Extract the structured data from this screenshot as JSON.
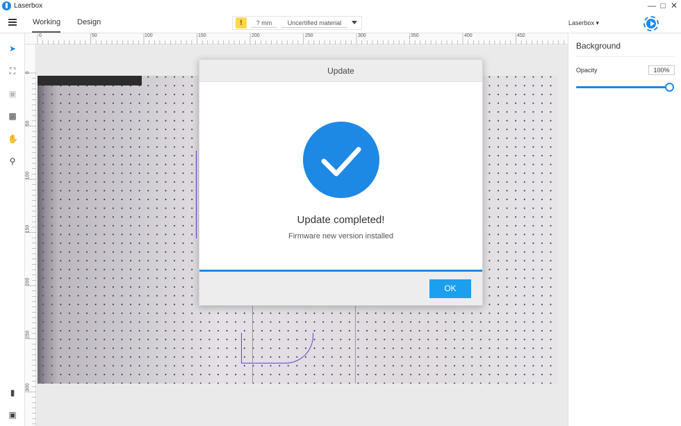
{
  "window": {
    "title": "Laserbox",
    "logo_icon": "laserbox-logo-icon",
    "controls": [
      "minimize-icon",
      "maximize-icon",
      "close-icon"
    ]
  },
  "toolbar": {
    "menu_icon": "hamburger-menu-icon",
    "tabs": [
      {
        "label": "Working",
        "active": true
      },
      {
        "label": "Design",
        "active": false
      }
    ],
    "warning_icon": "exclamation-icon",
    "thickness": "? mm",
    "material": "Uncertified material",
    "device": "Laserbox",
    "start_icon": "play-icon",
    "accent_color": "#1e88e5"
  },
  "tools": [
    {
      "name": "select-arrow-icon",
      "active": true
    },
    {
      "name": "crop-select-icon"
    },
    {
      "name": "image-icon",
      "disabled": true
    },
    {
      "name": "add-shape-icon"
    },
    {
      "name": "hand-pan-icon"
    },
    {
      "name": "zoom-icon"
    },
    {
      "name": "bookmark-icon"
    },
    {
      "name": "cart-icon"
    }
  ],
  "ruler": {
    "h_labels": [
      "0",
      "50",
      "100",
      "150",
      "200",
      "250",
      "300",
      "350",
      "400",
      "450"
    ],
    "v_labels": [
      "0",
      "50",
      "100",
      "150",
      "200",
      "250",
      "300"
    ]
  },
  "panel": {
    "title": "Background",
    "opacity_label": "Opacity",
    "opacity_value": "100%",
    "opacity_level": 1.0
  },
  "dialog": {
    "title": "Update",
    "icon": "check-circle-icon",
    "heading": "Update completed!",
    "subtext": "Firmware new version installed",
    "progress": 1.0,
    "ok_label": "OK"
  }
}
